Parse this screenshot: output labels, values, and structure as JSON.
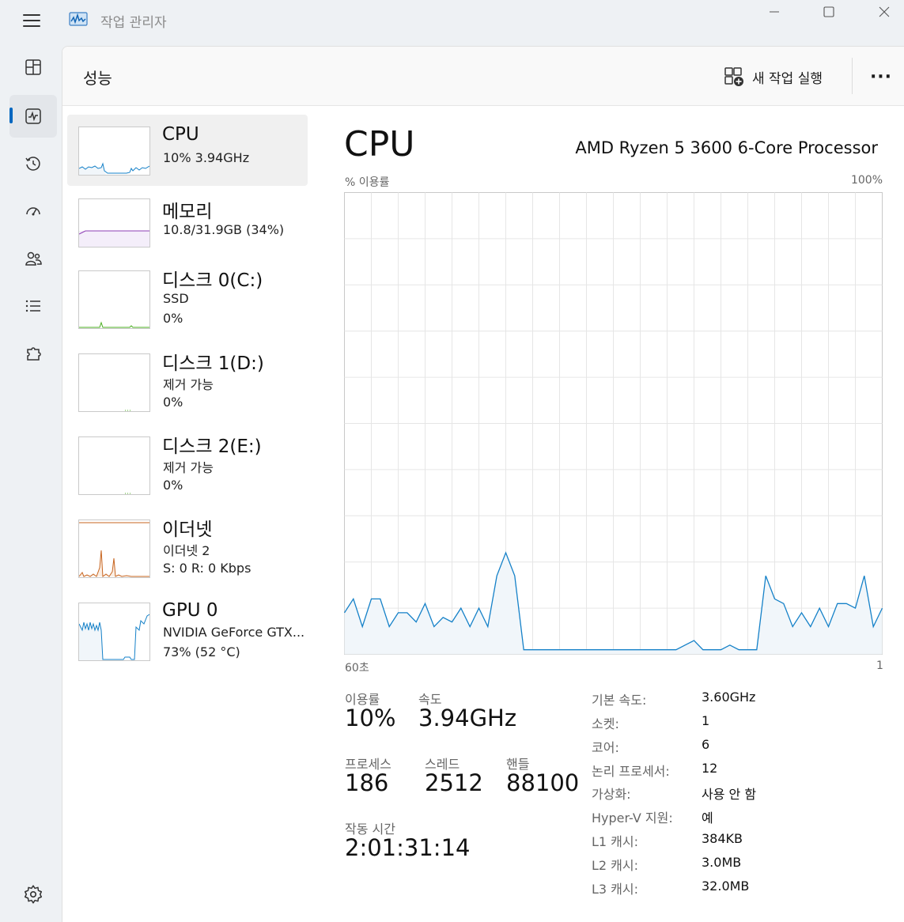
{
  "window": {
    "title": "작업 관리자"
  },
  "header": {
    "title": "성능",
    "run_task": "새 작업 실행"
  },
  "resources": [
    {
      "name": "CPU",
      "line1": "10%  3.94GHz",
      "line2": ""
    },
    {
      "name": "메모리",
      "line1": "10.8/31.9GB (34%)",
      "line2": ""
    },
    {
      "name": "디스크 0(C:)",
      "line1": "SSD",
      "line2": "0%"
    },
    {
      "name": "디스크 1(D:)",
      "line1": "제거 가능",
      "line2": "0%"
    },
    {
      "name": "디스크 2(E:)",
      "line1": "제거 가능",
      "line2": "0%"
    },
    {
      "name": "이더넷",
      "line1": "이더넷 2",
      "line2": "S: 0  R: 0 Kbps"
    },
    {
      "name": "GPU 0",
      "line1": "NVIDIA GeForce GTX...",
      "line2": "73% (52 °C)"
    }
  ],
  "main": {
    "title": "CPU",
    "model": "AMD Ryzen 5 3600 6-Core Processor",
    "y_label": "% 이용률",
    "y_max": "100%",
    "x_left": "60초",
    "x_right": "1"
  },
  "stats": {
    "util_label": "이용률",
    "util_value": "10%",
    "speed_label": "속도",
    "speed_value": "3.94GHz",
    "proc_label": "프로세스",
    "proc_value": "186",
    "thread_label": "스레드",
    "thread_value": "2512",
    "handle_label": "핸들",
    "handle_value": "88100",
    "uptime_label": "작동 시간",
    "uptime_value": "2:01:31:14"
  },
  "specs": [
    {
      "label": "기본 속도:",
      "value": "3.60GHz"
    },
    {
      "label": "소켓:",
      "value": "1"
    },
    {
      "label": "코어:",
      "value": "6"
    },
    {
      "label": "논리 프로세서:",
      "value": "12"
    },
    {
      "label": "가상화:",
      "value": "사용 안 함"
    },
    {
      "label": "Hyper-V 지원:",
      "value": "예"
    },
    {
      "label": "L1 캐시:",
      "value": "384KB"
    },
    {
      "label": "L2 캐시:",
      "value": "3.0MB"
    },
    {
      "label": "L3 캐시:",
      "value": "32.0MB"
    }
  ],
  "chart_data": {
    "type": "area",
    "x_range": [
      60,
      1
    ],
    "ylim": [
      0,
      100
    ],
    "grid": true,
    "series": [
      {
        "values": [
          9,
          12,
          6,
          12,
          12,
          6,
          9,
          9,
          7,
          11,
          6,
          8,
          7,
          10,
          6,
          10,
          6,
          17,
          22,
          17,
          1,
          1,
          1,
          1,
          1,
          1,
          1,
          1,
          1,
          1,
          1,
          1,
          1,
          1,
          1,
          1,
          1,
          1,
          2,
          3,
          1,
          1,
          1,
          2,
          1,
          1,
          1,
          17,
          12,
          11,
          6,
          9,
          6,
          10,
          6,
          11,
          11,
          10,
          17,
          6,
          10
        ]
      }
    ],
    "colors": {
      "line": "#1581c8",
      "fill": "#f1f6fa",
      "grid": "#e6e6e6"
    }
  }
}
